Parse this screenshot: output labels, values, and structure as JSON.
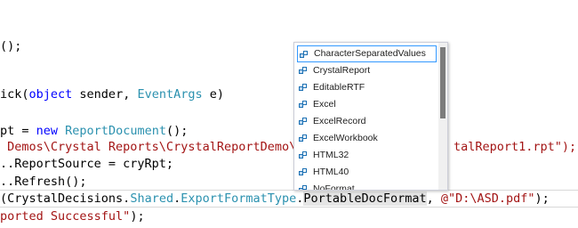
{
  "code_lines": [
    [
      "",
      "();",
      "",
      "",
      "",
      "",
      "",
      "",
      ""
    ],
    [
      "",
      "ick(",
      "object",
      " sender, ",
      "EventArgs",
      " e)",
      "",
      "",
      ""
    ],
    [
      "",
      "pt = ",
      "new",
      " ",
      "ReportDocument",
      "();",
      "",
      "",
      ""
    ],
    [
      "",
      "",
      "",
      "",
      "",
      "",
      "",
      "",
      ""
    ],
    [
      "",
      "..ReportSource = cryRpt;",
      "",
      "",
      "",
      "",
      "",
      "",
      ""
    ],
    [
      "",
      "..Refresh();",
      "",
      "",
      "",
      "",
      "",
      "",
      ""
    ]
  ],
  "line_path": {
    "start": " Demos\\Crystal Reports\\CrystalReportDemo\\C",
    "end": "talReport1.rpt\");"
  },
  "line_export": {
    "p1": "(CrystalDecisions.",
    "t1": "Shared",
    "p2": ".",
    "t2": "ExportFormatType",
    "p3": ".",
    "hl": "PortableDocFormat",
    "p4": ", ",
    "s1": "@\"D:\\ASD.pdf\"",
    "p5": ");"
  },
  "line_msg": {
    "s1": "ported Successful\"",
    "p1": ");"
  },
  "intellisense": {
    "items": [
      "CharacterSeparatedValues",
      "CrystalReport",
      "EditableRTF",
      "Excel",
      "ExcelRecord",
      "ExcelWorkbook",
      "HTML32",
      "HTML40",
      "NoFormat"
    ],
    "selected_index": 0,
    "icon": "enum-member-icon"
  },
  "colors": {
    "keyword": "#0000ff",
    "type": "#2b91af",
    "string": "#a31515",
    "selection_border": "#3399ff"
  }
}
